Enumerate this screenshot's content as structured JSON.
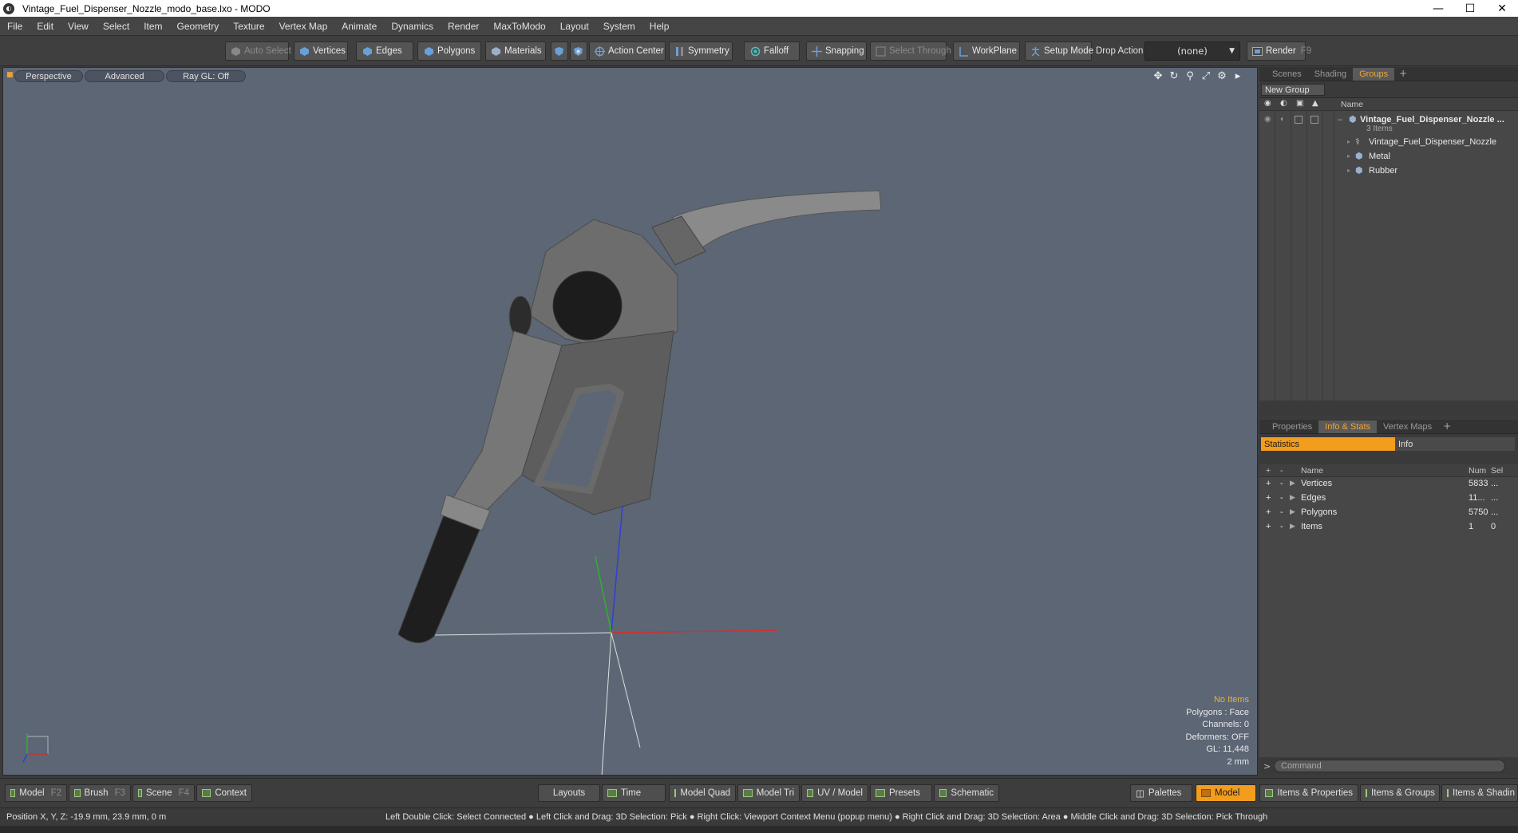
{
  "window": {
    "title": "Vintage_Fuel_Dispenser_Nozzle_modo_base.lxo - MODO",
    "app_icon": "modo-logo-icon",
    "controls": [
      "minimize-icon",
      "maximize-icon",
      "close-icon"
    ]
  },
  "menu": [
    "File",
    "Edit",
    "View",
    "Select",
    "Item",
    "Geometry",
    "Texture",
    "Vertex Map",
    "Animate",
    "Dynamics",
    "Render",
    "MaxToModo",
    "Layout",
    "System",
    "Help"
  ],
  "toolbar": {
    "auto_select": "Auto Select",
    "vertices": "Vertices",
    "edges": "Edges",
    "polygons": "Polygons",
    "materials": "Materials",
    "action_center": "Action Center",
    "symmetry": "Symmetry",
    "falloff": "Falloff",
    "snapping": "Snapping",
    "select_through": "Select Through",
    "workplane": "WorkPlane",
    "setup_mode": "Setup Mode",
    "drop_action_label": "Drop Action",
    "drop_action_value": "(none)",
    "render": "Render",
    "render_key": "F9"
  },
  "viewport": {
    "view_mode": "Perspective",
    "shading": "Advanced",
    "raygl": "Ray GL: Off",
    "info": {
      "selection": "No Items",
      "polygons": "Polygons : Face",
      "channels": "Channels: 0",
      "deformers": "Deformers: OFF",
      "gl": "GL: 11,448",
      "scale": "2 mm"
    },
    "colors": {
      "background": "#5c6675",
      "x_axis": "#d03030",
      "y_axis": "#30b030",
      "z_axis": "#3040d0"
    }
  },
  "groups_panel": {
    "tabs": [
      "Scenes",
      "Shading",
      "Groups"
    ],
    "active_tab": "Groups",
    "new_group": "New Group",
    "column_name": "Name",
    "root": {
      "name": "Vintage_Fuel_Dispenser_Nozzle ...",
      "count": "3 Items"
    },
    "children": [
      {
        "name": "Vintage_Fuel_Dispenser_Nozzle",
        "icon": "locator-icon"
      },
      {
        "name": "Metal",
        "icon": "mesh-icon"
      },
      {
        "name": "Rubber",
        "icon": "mesh-icon"
      }
    ]
  },
  "stats_panel": {
    "tabs": [
      "Properties",
      "Info & Stats",
      "Vertex Maps"
    ],
    "active_tab": "Info & Stats",
    "subtabs": [
      "Statistics",
      "Info"
    ],
    "columns": {
      "name": "Name",
      "num": "Num",
      "sel": "Sel"
    },
    "rows": [
      {
        "name": "Vertices",
        "num": "5833",
        "sel": "..."
      },
      {
        "name": "Edges",
        "num": "11...",
        "sel": "..."
      },
      {
        "name": "Polygons",
        "num": "5750",
        "sel": "..."
      },
      {
        "name": "Items",
        "num": "1",
        "sel": "0"
      }
    ]
  },
  "command": {
    "placeholder": "Command"
  },
  "bottombar": {
    "model": "Model",
    "model_key": "F2",
    "brush": "Brush",
    "brush_key": "F3",
    "scene": "Scene",
    "scene_key": "F4",
    "context": "Context",
    "layouts": "Layouts",
    "time": "Time",
    "model_quad": "Model Quad",
    "model_tri": "Model Tri",
    "uv_model": "UV / Model",
    "presets": "Presets",
    "schematic": "Schematic",
    "palettes": "Palettes",
    "model_active": "Model",
    "items_properties": "Items & Properties",
    "items_groups": "Items & Groups",
    "items_shading": "Items & Shadin"
  },
  "status": {
    "position": "Position X, Y, Z:  -19.9 mm, 23.9 mm, 0 m",
    "hints": "Left Double Click: Select Connected ● Left Click and Drag: 3D Selection: Pick ● Right Click: Viewport Context Menu (popup menu) ● Right Click and Drag: 3D Selection: Area ● Middle Click and Drag: 3D Selection: Pick Through"
  }
}
